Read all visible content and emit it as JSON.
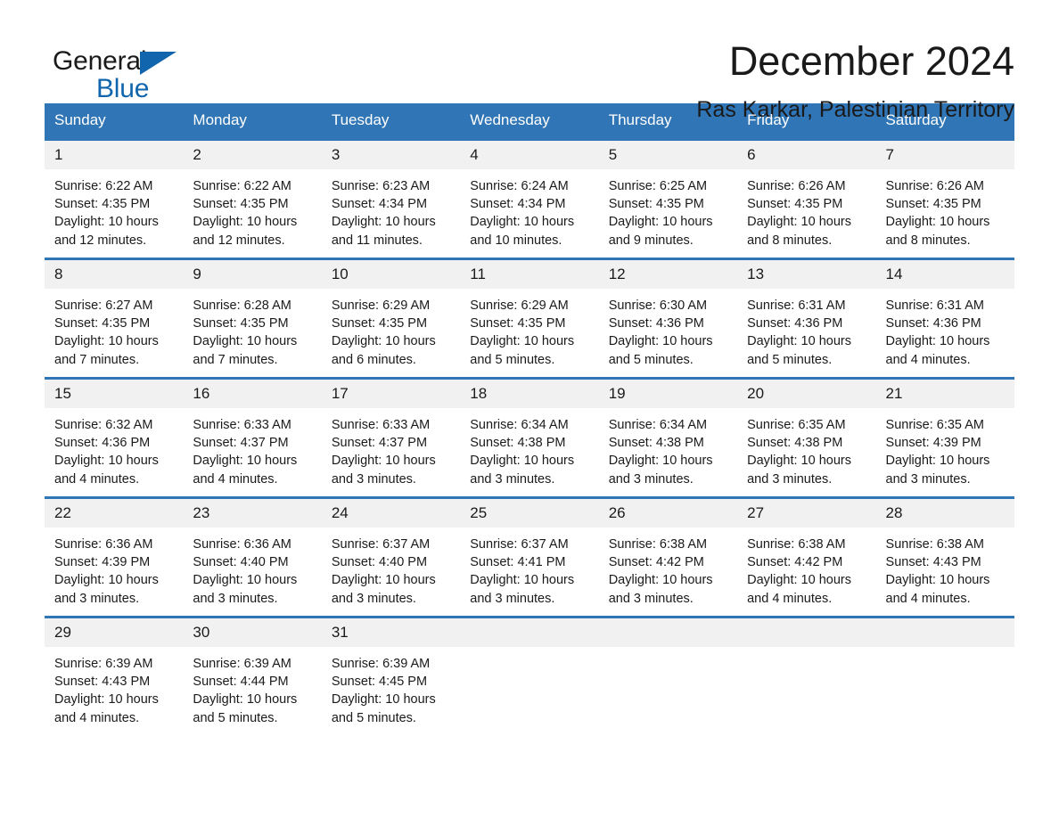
{
  "brand": {
    "name_part1": "General",
    "name_part2": "Blue",
    "logo_icon": "triangle-flag-icon",
    "accent_color": "#1065ad"
  },
  "header": {
    "month_title": "December 2024",
    "location": "Ras Karkar, Palestinian Territory"
  },
  "calendar": {
    "header_bg_color": "#3075b5",
    "daynum_bg_color": "#f1f1f1",
    "weekday_headers": [
      "Sunday",
      "Monday",
      "Tuesday",
      "Wednesday",
      "Thursday",
      "Friday",
      "Saturday"
    ],
    "weeks": [
      [
        {
          "day": "1",
          "sunrise": "Sunrise: 6:22 AM",
          "sunset": "Sunset: 4:35 PM",
          "daylight_line1": "Daylight: 10 hours",
          "daylight_line2": "and 12 minutes."
        },
        {
          "day": "2",
          "sunrise": "Sunrise: 6:22 AM",
          "sunset": "Sunset: 4:35 PM",
          "daylight_line1": "Daylight: 10 hours",
          "daylight_line2": "and 12 minutes."
        },
        {
          "day": "3",
          "sunrise": "Sunrise: 6:23 AM",
          "sunset": "Sunset: 4:34 PM",
          "daylight_line1": "Daylight: 10 hours",
          "daylight_line2": "and 11 minutes."
        },
        {
          "day": "4",
          "sunrise": "Sunrise: 6:24 AM",
          "sunset": "Sunset: 4:34 PM",
          "daylight_line1": "Daylight: 10 hours",
          "daylight_line2": "and 10 minutes."
        },
        {
          "day": "5",
          "sunrise": "Sunrise: 6:25 AM",
          "sunset": "Sunset: 4:35 PM",
          "daylight_line1": "Daylight: 10 hours",
          "daylight_line2": "and 9 minutes."
        },
        {
          "day": "6",
          "sunrise": "Sunrise: 6:26 AM",
          "sunset": "Sunset: 4:35 PM",
          "daylight_line1": "Daylight: 10 hours",
          "daylight_line2": "and 8 minutes."
        },
        {
          "day": "7",
          "sunrise": "Sunrise: 6:26 AM",
          "sunset": "Sunset: 4:35 PM",
          "daylight_line1": "Daylight: 10 hours",
          "daylight_line2": "and 8 minutes."
        }
      ],
      [
        {
          "day": "8",
          "sunrise": "Sunrise: 6:27 AM",
          "sunset": "Sunset: 4:35 PM",
          "daylight_line1": "Daylight: 10 hours",
          "daylight_line2": "and 7 minutes."
        },
        {
          "day": "9",
          "sunrise": "Sunrise: 6:28 AM",
          "sunset": "Sunset: 4:35 PM",
          "daylight_line1": "Daylight: 10 hours",
          "daylight_line2": "and 7 minutes."
        },
        {
          "day": "10",
          "sunrise": "Sunrise: 6:29 AM",
          "sunset": "Sunset: 4:35 PM",
          "daylight_line1": "Daylight: 10 hours",
          "daylight_line2": "and 6 minutes."
        },
        {
          "day": "11",
          "sunrise": "Sunrise: 6:29 AM",
          "sunset": "Sunset: 4:35 PM",
          "daylight_line1": "Daylight: 10 hours",
          "daylight_line2": "and 5 minutes."
        },
        {
          "day": "12",
          "sunrise": "Sunrise: 6:30 AM",
          "sunset": "Sunset: 4:36 PM",
          "daylight_line1": "Daylight: 10 hours",
          "daylight_line2": "and 5 minutes."
        },
        {
          "day": "13",
          "sunrise": "Sunrise: 6:31 AM",
          "sunset": "Sunset: 4:36 PM",
          "daylight_line1": "Daylight: 10 hours",
          "daylight_line2": "and 5 minutes."
        },
        {
          "day": "14",
          "sunrise": "Sunrise: 6:31 AM",
          "sunset": "Sunset: 4:36 PM",
          "daylight_line1": "Daylight: 10 hours",
          "daylight_line2": "and 4 minutes."
        }
      ],
      [
        {
          "day": "15",
          "sunrise": "Sunrise: 6:32 AM",
          "sunset": "Sunset: 4:36 PM",
          "daylight_line1": "Daylight: 10 hours",
          "daylight_line2": "and 4 minutes."
        },
        {
          "day": "16",
          "sunrise": "Sunrise: 6:33 AM",
          "sunset": "Sunset: 4:37 PM",
          "daylight_line1": "Daylight: 10 hours",
          "daylight_line2": "and 4 minutes."
        },
        {
          "day": "17",
          "sunrise": "Sunrise: 6:33 AM",
          "sunset": "Sunset: 4:37 PM",
          "daylight_line1": "Daylight: 10 hours",
          "daylight_line2": "and 3 minutes."
        },
        {
          "day": "18",
          "sunrise": "Sunrise: 6:34 AM",
          "sunset": "Sunset: 4:38 PM",
          "daylight_line1": "Daylight: 10 hours",
          "daylight_line2": "and 3 minutes."
        },
        {
          "day": "19",
          "sunrise": "Sunrise: 6:34 AM",
          "sunset": "Sunset: 4:38 PM",
          "daylight_line1": "Daylight: 10 hours",
          "daylight_line2": "and 3 minutes."
        },
        {
          "day": "20",
          "sunrise": "Sunrise: 6:35 AM",
          "sunset": "Sunset: 4:38 PM",
          "daylight_line1": "Daylight: 10 hours",
          "daylight_line2": "and 3 minutes."
        },
        {
          "day": "21",
          "sunrise": "Sunrise: 6:35 AM",
          "sunset": "Sunset: 4:39 PM",
          "daylight_line1": "Daylight: 10 hours",
          "daylight_line2": "and 3 minutes."
        }
      ],
      [
        {
          "day": "22",
          "sunrise": "Sunrise: 6:36 AM",
          "sunset": "Sunset: 4:39 PM",
          "daylight_line1": "Daylight: 10 hours",
          "daylight_line2": "and 3 minutes."
        },
        {
          "day": "23",
          "sunrise": "Sunrise: 6:36 AM",
          "sunset": "Sunset: 4:40 PM",
          "daylight_line1": "Daylight: 10 hours",
          "daylight_line2": "and 3 minutes."
        },
        {
          "day": "24",
          "sunrise": "Sunrise: 6:37 AM",
          "sunset": "Sunset: 4:40 PM",
          "daylight_line1": "Daylight: 10 hours",
          "daylight_line2": "and 3 minutes."
        },
        {
          "day": "25",
          "sunrise": "Sunrise: 6:37 AM",
          "sunset": "Sunset: 4:41 PM",
          "daylight_line1": "Daylight: 10 hours",
          "daylight_line2": "and 3 minutes."
        },
        {
          "day": "26",
          "sunrise": "Sunrise: 6:38 AM",
          "sunset": "Sunset: 4:42 PM",
          "daylight_line1": "Daylight: 10 hours",
          "daylight_line2": "and 3 minutes."
        },
        {
          "day": "27",
          "sunrise": "Sunrise: 6:38 AM",
          "sunset": "Sunset: 4:42 PM",
          "daylight_line1": "Daylight: 10 hours",
          "daylight_line2": "and 4 minutes."
        },
        {
          "day": "28",
          "sunrise": "Sunrise: 6:38 AM",
          "sunset": "Sunset: 4:43 PM",
          "daylight_line1": "Daylight: 10 hours",
          "daylight_line2": "and 4 minutes."
        }
      ],
      [
        {
          "day": "29",
          "sunrise": "Sunrise: 6:39 AM",
          "sunset": "Sunset: 4:43 PM",
          "daylight_line1": "Daylight: 10 hours",
          "daylight_line2": "and 4 minutes."
        },
        {
          "day": "30",
          "sunrise": "Sunrise: 6:39 AM",
          "sunset": "Sunset: 4:44 PM",
          "daylight_line1": "Daylight: 10 hours",
          "daylight_line2": "and 5 minutes."
        },
        {
          "day": "31",
          "sunrise": "Sunrise: 6:39 AM",
          "sunset": "Sunset: 4:45 PM",
          "daylight_line1": "Daylight: 10 hours",
          "daylight_line2": "and 5 minutes."
        },
        {
          "day": "",
          "sunrise": "",
          "sunset": "",
          "daylight_line1": "",
          "daylight_line2": ""
        },
        {
          "day": "",
          "sunrise": "",
          "sunset": "",
          "daylight_line1": "",
          "daylight_line2": ""
        },
        {
          "day": "",
          "sunrise": "",
          "sunset": "",
          "daylight_line1": "",
          "daylight_line2": ""
        },
        {
          "day": "",
          "sunrise": "",
          "sunset": "",
          "daylight_line1": "",
          "daylight_line2": ""
        }
      ]
    ]
  }
}
